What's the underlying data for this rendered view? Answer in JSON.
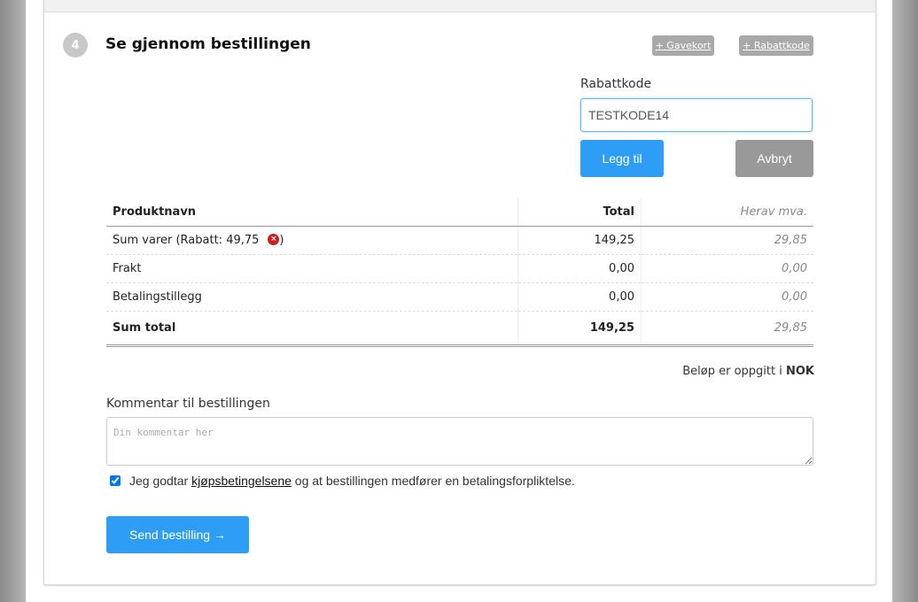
{
  "step": {
    "number": "4",
    "title": "Se gjennom bestillingen"
  },
  "actions": {
    "gift_card_label": "+ Gavekort",
    "coupon_label": "+ Rabattkode"
  },
  "coupon": {
    "label": "Rabattkode",
    "value": "TESTKODE14",
    "add_label": "Legg til",
    "cancel_label": "Avbryt"
  },
  "summary": {
    "headers": {
      "name": "Produktnavn",
      "total": "Total",
      "vat": "Herav mva."
    },
    "rows": [
      {
        "name": "Sum varer (Rabatt: 49,75",
        "name_suffix": ")",
        "total": "149,25",
        "vat": "29,85",
        "has_remove": true
      },
      {
        "name": "Frakt",
        "total": "0,00",
        "vat": "0,00"
      },
      {
        "name": "Betalingstillegg",
        "total": "0,00",
        "vat": "0,00"
      }
    ],
    "grand_total": {
      "name": "Sum total",
      "total": "149,25",
      "vat": "29,85"
    }
  },
  "currency_note": {
    "prefix": "Beløp er oppgitt i ",
    "currency": "NOK"
  },
  "comment": {
    "label": "Kommentar til bestillingen",
    "placeholder": "Din kommentar her"
  },
  "terms": {
    "checked": true,
    "prefix": "Jeg godtar ",
    "link": "kjøpsbetingelsene",
    "suffix": " og at bestillingen medfører en betalingsforpliktelse."
  },
  "submit_label": "Send bestilling →",
  "icons": {
    "remove": "remove-discount-icon"
  },
  "colors": {
    "primary": "#2d9df5",
    "muted_button": "#999999",
    "remove": "#c91e1e"
  }
}
